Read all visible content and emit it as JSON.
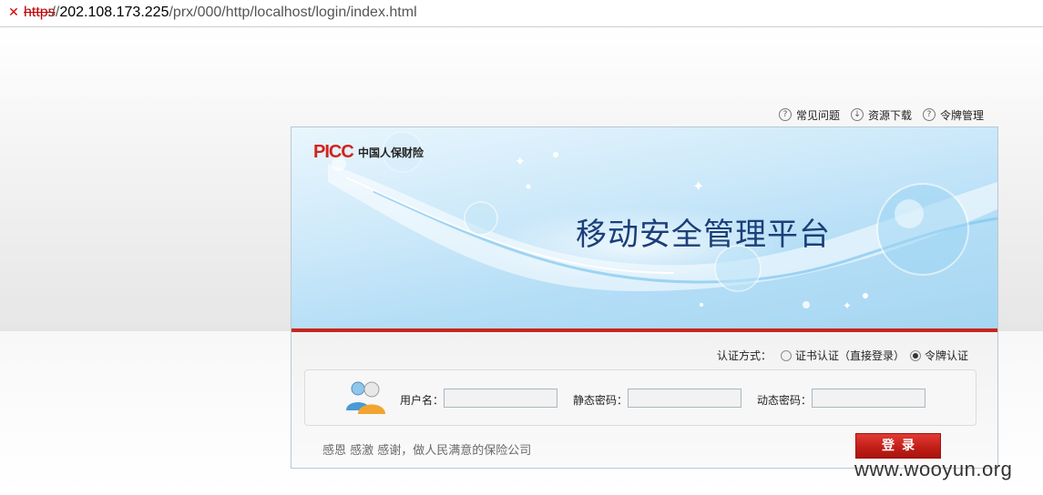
{
  "browser": {
    "address_icon": "broken-lock-icon",
    "address_scheme": "https",
    "address_sep": "://",
    "address_host": "202.108.173.225",
    "address_path": "/prx/000/http/localhost/login/index.html"
  },
  "top_links": [
    {
      "label": "常见问题",
      "icon": "question-icon",
      "glyph": "?"
    },
    {
      "label": "资源下载",
      "icon": "download-icon",
      "glyph": "↓"
    },
    {
      "label": "令牌管理",
      "icon": "question-icon",
      "glyph": "?"
    }
  ],
  "banner": {
    "logo": "PICC",
    "logo_cn": "中国人保财险",
    "title": "移动安全管理平台"
  },
  "auth": {
    "label": "认证方式：",
    "options": [
      {
        "label": "证书认证（直接登录）",
        "checked": false
      },
      {
        "label": "令牌认证",
        "checked": true
      }
    ]
  },
  "form": {
    "username_label": "用户名：",
    "static_password_label": "静态密码：",
    "dynamic_password_label": "动态密码：",
    "username_value": "",
    "static_password_value": "",
    "dynamic_password_value": ""
  },
  "slogan": "感恩 感激 感谢，做人民满意的保险公司",
  "login_button": "登录",
  "watermark": "www.wooyun.org",
  "colors": {
    "brand_red": "#c8261d",
    "title_blue": "#1b3f79"
  }
}
